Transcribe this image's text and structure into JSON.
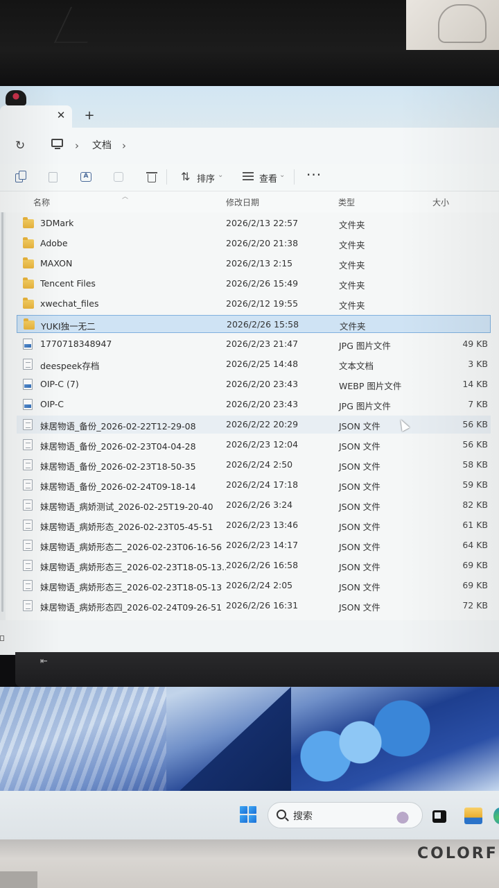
{
  "tabs": {
    "close": "✕",
    "new_tab": "+"
  },
  "address": {
    "crumbs": [
      "文档"
    ]
  },
  "toolbar": {
    "sort_label": "排序",
    "view_label": "查看",
    "more_label": "···"
  },
  "columns": {
    "name": "名称",
    "date": "修改日期",
    "type": "类型",
    "size": "大小"
  },
  "files": [
    {
      "name": "3DMark",
      "date": "2026/2/13 22:57",
      "type": "文件夹",
      "size": "",
      "icon": "folder"
    },
    {
      "name": "Adobe",
      "date": "2026/2/20 21:38",
      "type": "文件夹",
      "size": "",
      "icon": "folder"
    },
    {
      "name": "MAXON",
      "date": "2026/2/13 2:15",
      "type": "文件夹",
      "size": "",
      "icon": "folder"
    },
    {
      "name": "Tencent Files",
      "date": "2026/2/26 15:49",
      "type": "文件夹",
      "size": "",
      "icon": "folder"
    },
    {
      "name": "xwechat_files",
      "date": "2026/2/12 19:55",
      "type": "文件夹",
      "size": "",
      "icon": "folder"
    },
    {
      "name": "YUKI独一无二",
      "date": "2026/2/26 15:58",
      "type": "文件夹",
      "size": "",
      "icon": "folder",
      "selected": true
    },
    {
      "name": "1770718348947",
      "date": "2026/2/23 21:47",
      "type": "JPG 图片文件",
      "size": "49 KB",
      "icon": "image"
    },
    {
      "name": "deespeek存档",
      "date": "2026/2/25 14:48",
      "type": "文本文档",
      "size": "3 KB",
      "icon": "doc"
    },
    {
      "name": "OIP-C (7)",
      "date": "2026/2/20 23:43",
      "type": "WEBP 图片文件",
      "size": "14 KB",
      "icon": "image"
    },
    {
      "name": "OIP-C",
      "date": "2026/2/20 23:43",
      "type": "JPG 图片文件",
      "size": "7 KB",
      "icon": "image"
    },
    {
      "name": "妹居物语_备份_2026-02-22T12-29-08",
      "date": "2026/2/22 20:29",
      "type": "JSON 文件",
      "size": "56 KB",
      "icon": "doc",
      "hover": true
    },
    {
      "name": "妹居物语_备份_2026-02-23T04-04-28",
      "date": "2026/2/23 12:04",
      "type": "JSON 文件",
      "size": "56 KB",
      "icon": "doc"
    },
    {
      "name": "妹居物语_备份_2026-02-23T18-50-35",
      "date": "2026/2/24 2:50",
      "type": "JSON 文件",
      "size": "58 KB",
      "icon": "doc"
    },
    {
      "name": "妹居物语_备份_2026-02-24T09-18-14",
      "date": "2026/2/24 17:18",
      "type": "JSON 文件",
      "size": "59 KB",
      "icon": "doc"
    },
    {
      "name": "妹居物语_病娇测试_2026-02-25T19-20-40",
      "date": "2026/2/26 3:24",
      "type": "JSON 文件",
      "size": "82 KB",
      "icon": "doc"
    },
    {
      "name": "妹居物语_病娇形态_2026-02-23T05-45-51",
      "date": "2026/2/23 13:46",
      "type": "JSON 文件",
      "size": "61 KB",
      "icon": "doc"
    },
    {
      "name": "妹居物语_病娇形态二_2026-02-23T06-16-56",
      "date": "2026/2/23 14:17",
      "type": "JSON 文件",
      "size": "64 KB",
      "icon": "doc"
    },
    {
      "name": "妹居物语_病娇形态三_2026-02-23T18-05-13...",
      "date": "2026/2/26 16:58",
      "type": "JSON 文件",
      "size": "69 KB",
      "icon": "doc"
    },
    {
      "name": "妹居物语_病娇形态三_2026-02-23T18-05-13",
      "date": "2026/2/24 2:05",
      "type": "JSON 文件",
      "size": "69 KB",
      "icon": "doc"
    },
    {
      "name": "妹居物语_病娇形态四_2026-02-24T09-26-51",
      "date": "2026/2/26 16:31",
      "type": "JSON 文件",
      "size": "72 KB",
      "icon": "doc"
    }
  ],
  "taskbar": {
    "search_label": "搜索"
  },
  "hardware": {
    "brand": "COLORF"
  },
  "colors": {
    "selection": "#cfe3f4",
    "selection_border": "#7fb0de",
    "folder": "#f1c24f",
    "accent": "#1b6fd6"
  }
}
